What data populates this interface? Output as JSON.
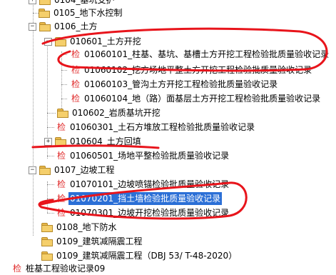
{
  "tree": {
    "items": [
      {
        "label": "0104_基坑支护",
        "type": "folder"
      },
      {
        "label": "0105_地下水控制",
        "type": "folder"
      },
      {
        "label": "0106_土方",
        "type": "folder",
        "expander": "−"
      },
      {
        "label": "010601_土方开挖",
        "type": "folder",
        "expander": "−"
      },
      {
        "label": "01060101_柱基、基坑、基槽土方开挖工程检验批质量验收记录",
        "type": "doc"
      },
      {
        "label": "01060102_挖方场地平整土方开挖工程检验批质量验收记录",
        "type": "doc"
      },
      {
        "label": "01060103_管沟土方开挖工程检验批质量验收记录",
        "type": "doc"
      },
      {
        "label": "01060104_地（路）面基层土方开挖工程检验批质量验收记录",
        "type": "doc"
      },
      {
        "label": "010602_岩质基坑开挖",
        "type": "folder"
      },
      {
        "label": "01060301_土石方堆放工程检验批质量验收记录",
        "type": "doc"
      },
      {
        "label": "010604_土方回填",
        "type": "folder",
        "expander": "+"
      },
      {
        "label": "01060501_场地平整检验批质量验收记录",
        "type": "doc"
      },
      {
        "label": "0107_边坡工程",
        "type": "folder",
        "expander": "−"
      },
      {
        "label": "01070101_边坡喷锚检验批质量验收记录",
        "type": "doc"
      },
      {
        "label": "01070201_挡土墙检验批质量验收记录",
        "type": "doc",
        "selected": true
      },
      {
        "label": "01070301_边坡开挖检验批质量验收记录",
        "type": "doc"
      },
      {
        "label": "0108_地下防水",
        "type": "folder"
      },
      {
        "label": "0109_建筑减隔震工程",
        "type": "folder"
      },
      {
        "label": "0109_建筑减隔震工程（DBJ 53/ T-48-2020）",
        "type": "folder"
      },
      {
        "label": "桩基工程验收记录09",
        "type": "doc"
      }
    ],
    "doc_icon_glyph": "检",
    "selection_color": "#2b6fd6",
    "annotation_color": "#e8141b"
  }
}
